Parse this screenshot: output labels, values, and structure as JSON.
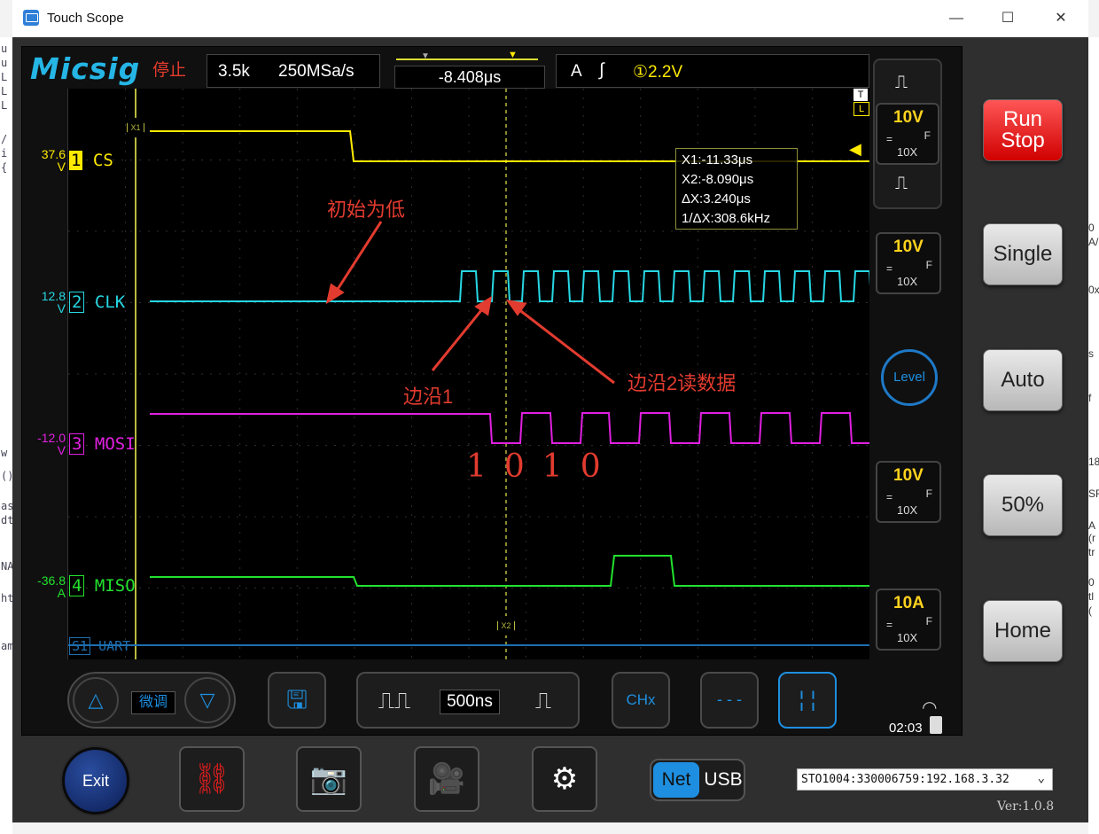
{
  "window": {
    "title": "Touch Scope",
    "minimize": "—",
    "maximize": "☐",
    "close": "✕"
  },
  "editor_sliver": [
    "u",
    "u",
    "L",
    "L",
    "L",
    "/",
    "i",
    "{",
    "w",
    "()",
    "as",
    "dt",
    "NA",
    "ht",
    "am"
  ],
  "scope": {
    "brand": "Micsig",
    "status": "停止",
    "memory": "3.5k",
    "sample_rate": "250MSa/s",
    "trigger_pos": "-8.408μs",
    "trigger_source": "A",
    "trigger_level": "①2.2V",
    "time_base": "500ns",
    "fine_label": "微调",
    "clock": "02:03",
    "x1_tag": "X1",
    "x2_tag": "X2",
    "trigger_marker": "T",
    "trigger_marker_l": "L"
  },
  "channels": [
    {
      "num": "1",
      "name": "CS",
      "offset": "37.6",
      "unit": "V",
      "color": "#ffea00"
    },
    {
      "num": "2",
      "name": "CLK",
      "offset": "12.8",
      "unit": "V",
      "color": "#27d7e3"
    },
    {
      "num": "3",
      "name": "MOSI",
      "offset": "-12.0",
      "unit": "V",
      "color": "#e020e0"
    },
    {
      "num": "4",
      "name": "MISO",
      "offset": "-36.8",
      "unit": "A",
      "color": "#22e22e"
    },
    {
      "num": "S1",
      "name": "UART",
      "offset": "",
      "unit": "",
      "color": "#1e6fb0"
    }
  ],
  "cursor_readout": {
    "x1": "X1:-11.33μs",
    "x2": "X2:-8.090μs",
    "dx": "ΔX:3.240μs",
    "inv_dx": "1/ΔX:308.6kHz"
  },
  "annotations": {
    "initial_low": "初始为低",
    "edge1": "边沿1",
    "edge2": "边沿2读数据",
    "handwriting": "1010"
  },
  "channel_settings": [
    {
      "volts": "10V",
      "coupling": "=",
      "bw": "F",
      "probe": "10X"
    },
    {
      "volts": "10V",
      "coupling": "=",
      "bw": "F",
      "probe": "10X"
    },
    {
      "volts": "10V",
      "coupling": "=",
      "bw": "F",
      "probe": "10X"
    },
    {
      "volts": "10A",
      "coupling": "=",
      "bw": "F",
      "probe": "10X"
    }
  ],
  "side_buttons": {
    "run": "Run",
    "stop": "Stop",
    "single": "Single",
    "auto": "Auto",
    "fifty": "50%",
    "home": "Home",
    "level": "Level"
  },
  "bottom": {
    "chx": "CHx",
    "exit": "Exit",
    "net": "Net",
    "usb": "USB",
    "device": "STO1004:330006759:192.168.3.32",
    "version": "Ver:1.0.8"
  },
  "right_sliver": [
    "0",
    "A/",
    "0x",
    "s",
    "f",
    "18",
    "SF",
    "A",
    "(r",
    "tr",
    "0",
    "tl",
    "("
  ]
}
